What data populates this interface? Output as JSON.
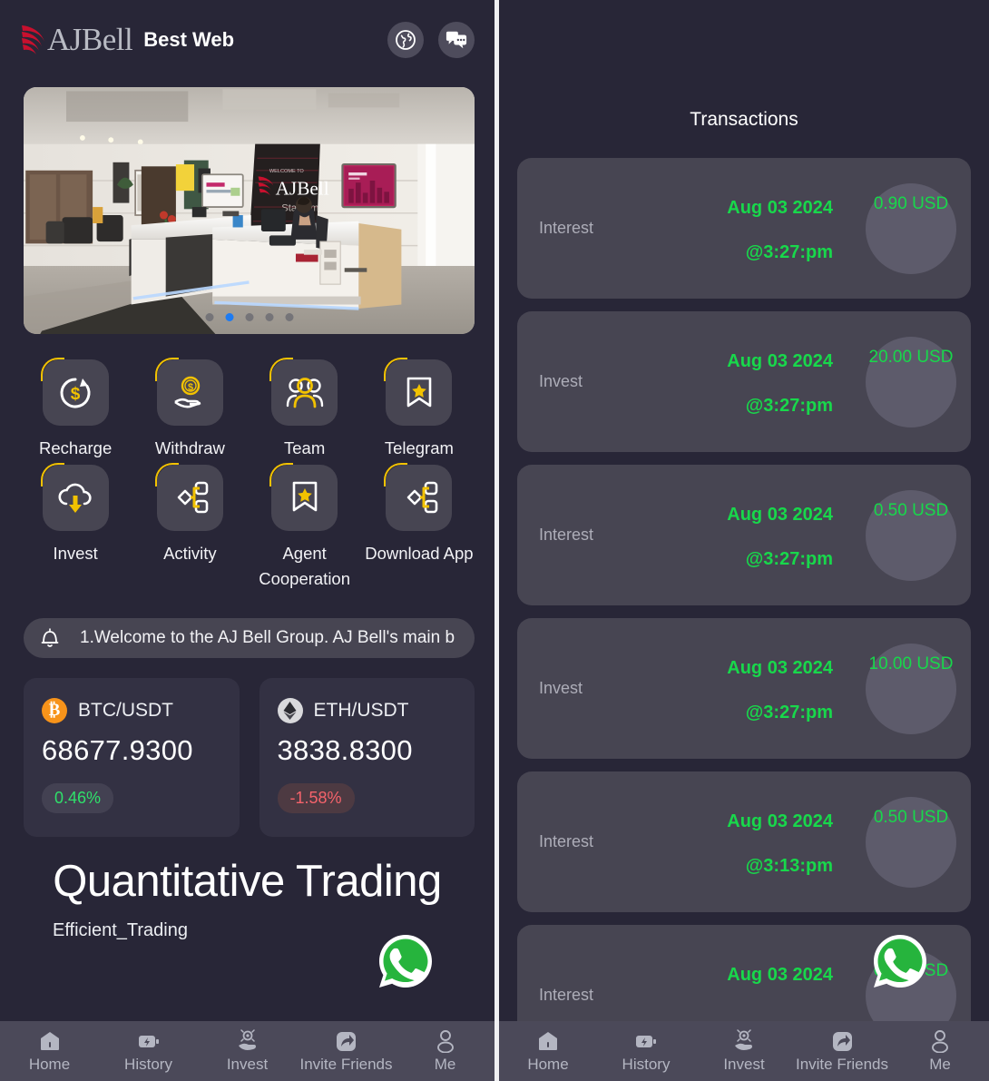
{
  "header": {
    "brand_word": "AJBell",
    "title": "Best Web",
    "globe_icon": "globe-icon",
    "chat_icon": "chat-icon"
  },
  "carousel": {
    "slide_alt": "AJ Bell Stadium reception lobby",
    "dot_count": 5,
    "active_dot": 2
  },
  "quick_actions": [
    {
      "label": "Recharge",
      "icon": "recharge-icon"
    },
    {
      "label": "Withdraw",
      "icon": "withdraw-icon"
    },
    {
      "label": "Team",
      "icon": "team-icon"
    },
    {
      "label": "Telegram",
      "icon": "bookmark-star-icon"
    },
    {
      "label": "Invest",
      "icon": "cloud-download-icon"
    },
    {
      "label": "Activity",
      "icon": "share-nodes-icon"
    },
    {
      "label": "Agent Cooperation",
      "icon": "bookmark-star-icon"
    },
    {
      "label": "Download App",
      "icon": "share-nodes-icon"
    }
  ],
  "notice": {
    "bell_icon": "bell-icon",
    "text": "1.Welcome to the AJ Bell Group. AJ Bell's main b"
  },
  "coins": [
    {
      "symbol": "BTC/USDT",
      "badge_glyph": "₿",
      "price": "68677.9300",
      "change": "0.46%",
      "direction": "up",
      "color": "#2fe06a"
    },
    {
      "symbol": "ETH/USDT",
      "badge_glyph": "♦",
      "price": "3838.8300",
      "change": "-1.58%",
      "direction": "down",
      "color": "#f5636b"
    }
  ],
  "hero": {
    "title": "Quantitative Trading",
    "subtitle": "Efficient_Trading"
  },
  "transactions": {
    "title": "Transactions",
    "rows": [
      {
        "type": "Interest",
        "date": "Aug 03 2024",
        "time": "@3:27:pm",
        "amount": "0.90 USD"
      },
      {
        "type": "Invest",
        "date": "Aug 03 2024",
        "time": "@3:27:pm",
        "amount": "20.00 USD"
      },
      {
        "type": "Interest",
        "date": "Aug 03 2024",
        "time": "@3:27:pm",
        "amount": "0.50 USD"
      },
      {
        "type": "Invest",
        "date": "Aug 03 2024",
        "time": "@3:27:pm",
        "amount": "10.00 USD"
      },
      {
        "type": "Interest",
        "date": "Aug 03 2024",
        "time": "@3:13:pm",
        "amount": "0.50 USD"
      },
      {
        "type": "Interest",
        "date": "Aug 03 2024",
        "time": "",
        "amount": "0.50 USD"
      }
    ]
  },
  "bottom_nav": [
    {
      "label": "Home",
      "icon": "home-icon"
    },
    {
      "label": "History",
      "icon": "battery-bolt-icon"
    },
    {
      "label": "Invest",
      "icon": "hand-coin-icon"
    },
    {
      "label": "Invite Friends",
      "icon": "share-arrow-icon"
    },
    {
      "label": "Me",
      "icon": "person-icon"
    }
  ],
  "floating_action": {
    "icon": "whatsapp-icon",
    "label": "WhatsApp"
  },
  "colors": {
    "page_bg": "#282637",
    "card_bg": "#474552",
    "accent_yellow": "#f2c200",
    "accent_green": "#18d84b",
    "accent_red": "#f5636b",
    "brand_red": "#c8102e"
  }
}
